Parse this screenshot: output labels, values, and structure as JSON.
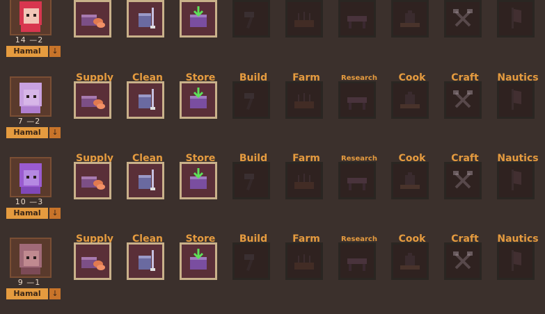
{
  "jobs": [
    "Supply",
    "Clean",
    "Store",
    "Build",
    "Farm",
    "Research",
    "Cook",
    "Craft",
    "Nautics"
  ],
  "job_state": [
    true,
    true,
    true,
    false,
    false,
    false,
    false,
    false,
    false
  ],
  "colonists": [
    {
      "stat_a": "14",
      "stat_b": "2",
      "job": "Hamal",
      "hair": "#d8364f",
      "skin": "#f2c6b8",
      "shirt": "#d8364f"
    },
    {
      "stat_a": "7",
      "stat_b": "2",
      "job": "Hamal",
      "hair": "#c9a1e0",
      "skin": "#d7b6e8",
      "shirt": "#b07fd0"
    },
    {
      "stat_a": "10",
      "stat_b": "3",
      "job": "Hamal",
      "hair": "#9a5bd0",
      "skin": "#b589e2",
      "shirt": "#8048b8"
    },
    {
      "stat_a": "9",
      "stat_b": "1",
      "job": "Hamal",
      "hair": "#a06a78",
      "skin": "#c08a90",
      "shirt": "#7c4a56"
    }
  ],
  "arrow_glyph": "↓",
  "icons": [
    "supply-crate-icon",
    "clean-mop-icon",
    "store-box-icon",
    "hammer-icon",
    "farm-plot-icon",
    "research-desk-icon",
    "cook-pot-icon",
    "crossed-tools-icon",
    "banner-icon"
  ]
}
